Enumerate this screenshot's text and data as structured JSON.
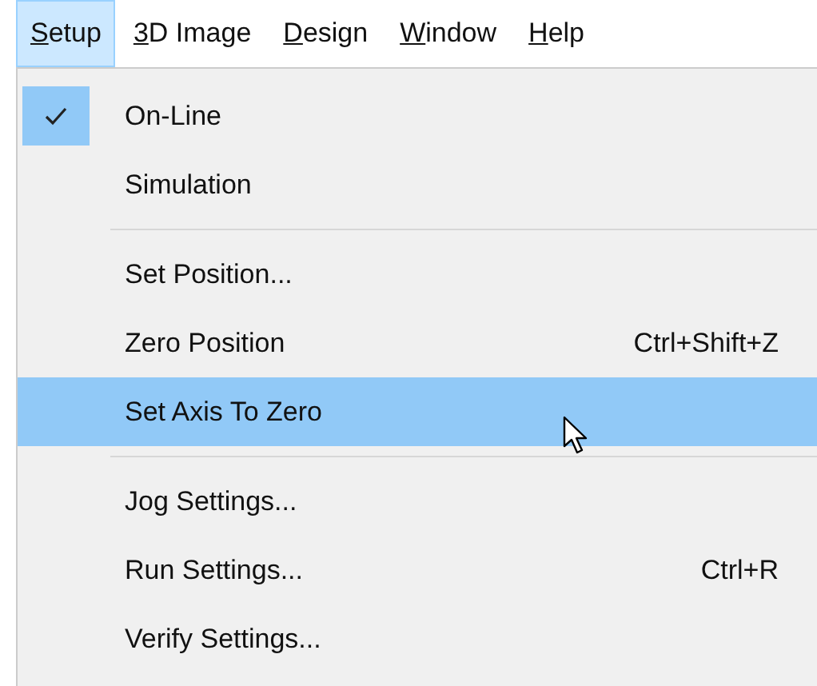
{
  "menu_bar": [
    {
      "label": "Setup",
      "selected": true
    },
    {
      "label": "3D Image",
      "selected": false
    },
    {
      "label": "Design",
      "selected": false
    },
    {
      "label": "Window",
      "selected": false
    },
    {
      "label": "Help",
      "selected": false
    }
  ],
  "menu": [
    {
      "kind": "item",
      "label": "On-Line",
      "checked": true,
      "selected": false
    },
    {
      "kind": "item",
      "label": "Simulation",
      "checked": false,
      "selected": false
    },
    {
      "kind": "separator"
    },
    {
      "kind": "item",
      "label": "Set Position...",
      "checked": false,
      "selected": false
    },
    {
      "kind": "item",
      "label": "Zero Position",
      "shortcut": "Ctrl+Shift+Z",
      "checked": false,
      "selected": false
    },
    {
      "kind": "item",
      "label": "Set Axis To Zero",
      "checked": false,
      "selected": true
    },
    {
      "kind": "separator"
    },
    {
      "kind": "item",
      "label": "Jog Settings...",
      "checked": false,
      "selected": false
    },
    {
      "kind": "item",
      "label": "Run Settings...",
      "shortcut": "Ctrl+R",
      "checked": false,
      "selected": false
    },
    {
      "kind": "item",
      "label": "Verify Settings...",
      "checked": false,
      "selected": false
    }
  ]
}
